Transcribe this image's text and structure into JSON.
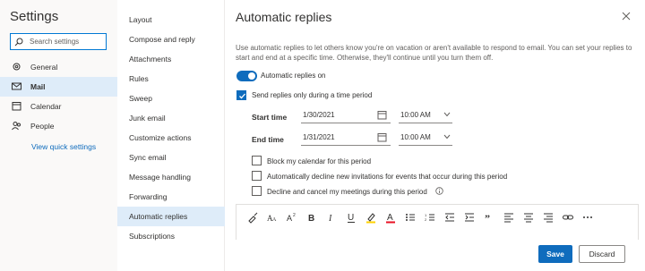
{
  "settings": {
    "title": "Settings",
    "search_placeholder": "Search settings",
    "nav": [
      {
        "label": "General",
        "icon": "gear-icon"
      },
      {
        "label": "Mail",
        "icon": "mail-icon"
      },
      {
        "label": "Calendar",
        "icon": "calendar-icon"
      },
      {
        "label": "People",
        "icon": "people-icon"
      }
    ],
    "quick_link": "View quick settings"
  },
  "mail_menu": {
    "items": [
      "Layout",
      "Compose and reply",
      "Attachments",
      "Rules",
      "Sweep",
      "Junk email",
      "Customize actions",
      "Sync email",
      "Message handling",
      "Forwarding",
      "Automatic replies",
      "Subscriptions"
    ],
    "active": "Automatic replies"
  },
  "panel": {
    "title": "Automatic replies",
    "description": "Use automatic replies to let others know you're on vacation or aren't available to respond to email. You can set your replies to start and end at a specific time. Otherwise, they'll continue until you turn them off.",
    "toggle_label": "Automatic replies on",
    "toggle_on": true,
    "time_period_label": "Send replies only during a time period",
    "time_period_checked": true,
    "start_label": "Start time",
    "start_date": "1/30/2021",
    "start_time": "10:00 AM",
    "end_label": "End time",
    "end_date": "1/31/2021",
    "end_time": "10:00 AM",
    "options": [
      {
        "label": "Block my calendar for this period",
        "checked": false
      },
      {
        "label": "Automatically decline new invitations for events that occur during this period",
        "checked": false
      },
      {
        "label": "Decline and cancel my meetings during this period",
        "checked": false
      }
    ],
    "save_label": "Save",
    "discard_label": "Discard"
  },
  "colors": {
    "accent": "#0f6cbd",
    "selected_bg": "#deecf9"
  }
}
